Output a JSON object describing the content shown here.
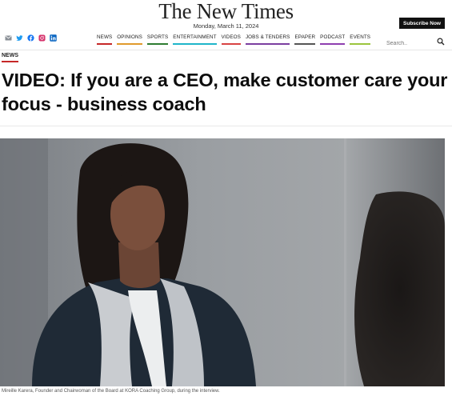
{
  "masthead": {
    "logo": "The New Times",
    "date": "Monday, March 11, 2024",
    "subscribe_label": "Subscribe Now"
  },
  "social": [
    "mail-icon",
    "twitter-icon",
    "facebook-icon",
    "instagram-icon",
    "linkedin-icon"
  ],
  "nav": {
    "items": [
      {
        "label": "NEWS",
        "color": "#c62828"
      },
      {
        "label": "OPINIONS",
        "color": "#e09a2c"
      },
      {
        "label": "SPORTS",
        "color": "#2e7d32"
      },
      {
        "label": "ENTERTAINMENT",
        "color": "#1fb5c9"
      },
      {
        "label": "VIDEOS",
        "color": "#d84343"
      },
      {
        "label": "JOBS & TENDERS",
        "color": "#7b3fa0"
      },
      {
        "label": "EPAPER",
        "color": "#555555"
      },
      {
        "label": "PODCAST",
        "color": "#8e3fb0"
      },
      {
        "label": "EVENTS",
        "color": "#9bc53d"
      }
    ]
  },
  "search": {
    "placeholder": "Search.."
  },
  "article": {
    "section": "NEWS",
    "headline": "VIDEO: If you are a CEO, make customer care your focus - business coach",
    "caption": "Mireille Karera, Founder and Chairwoman of the Board at KORA Coaching Group, during the interview."
  }
}
